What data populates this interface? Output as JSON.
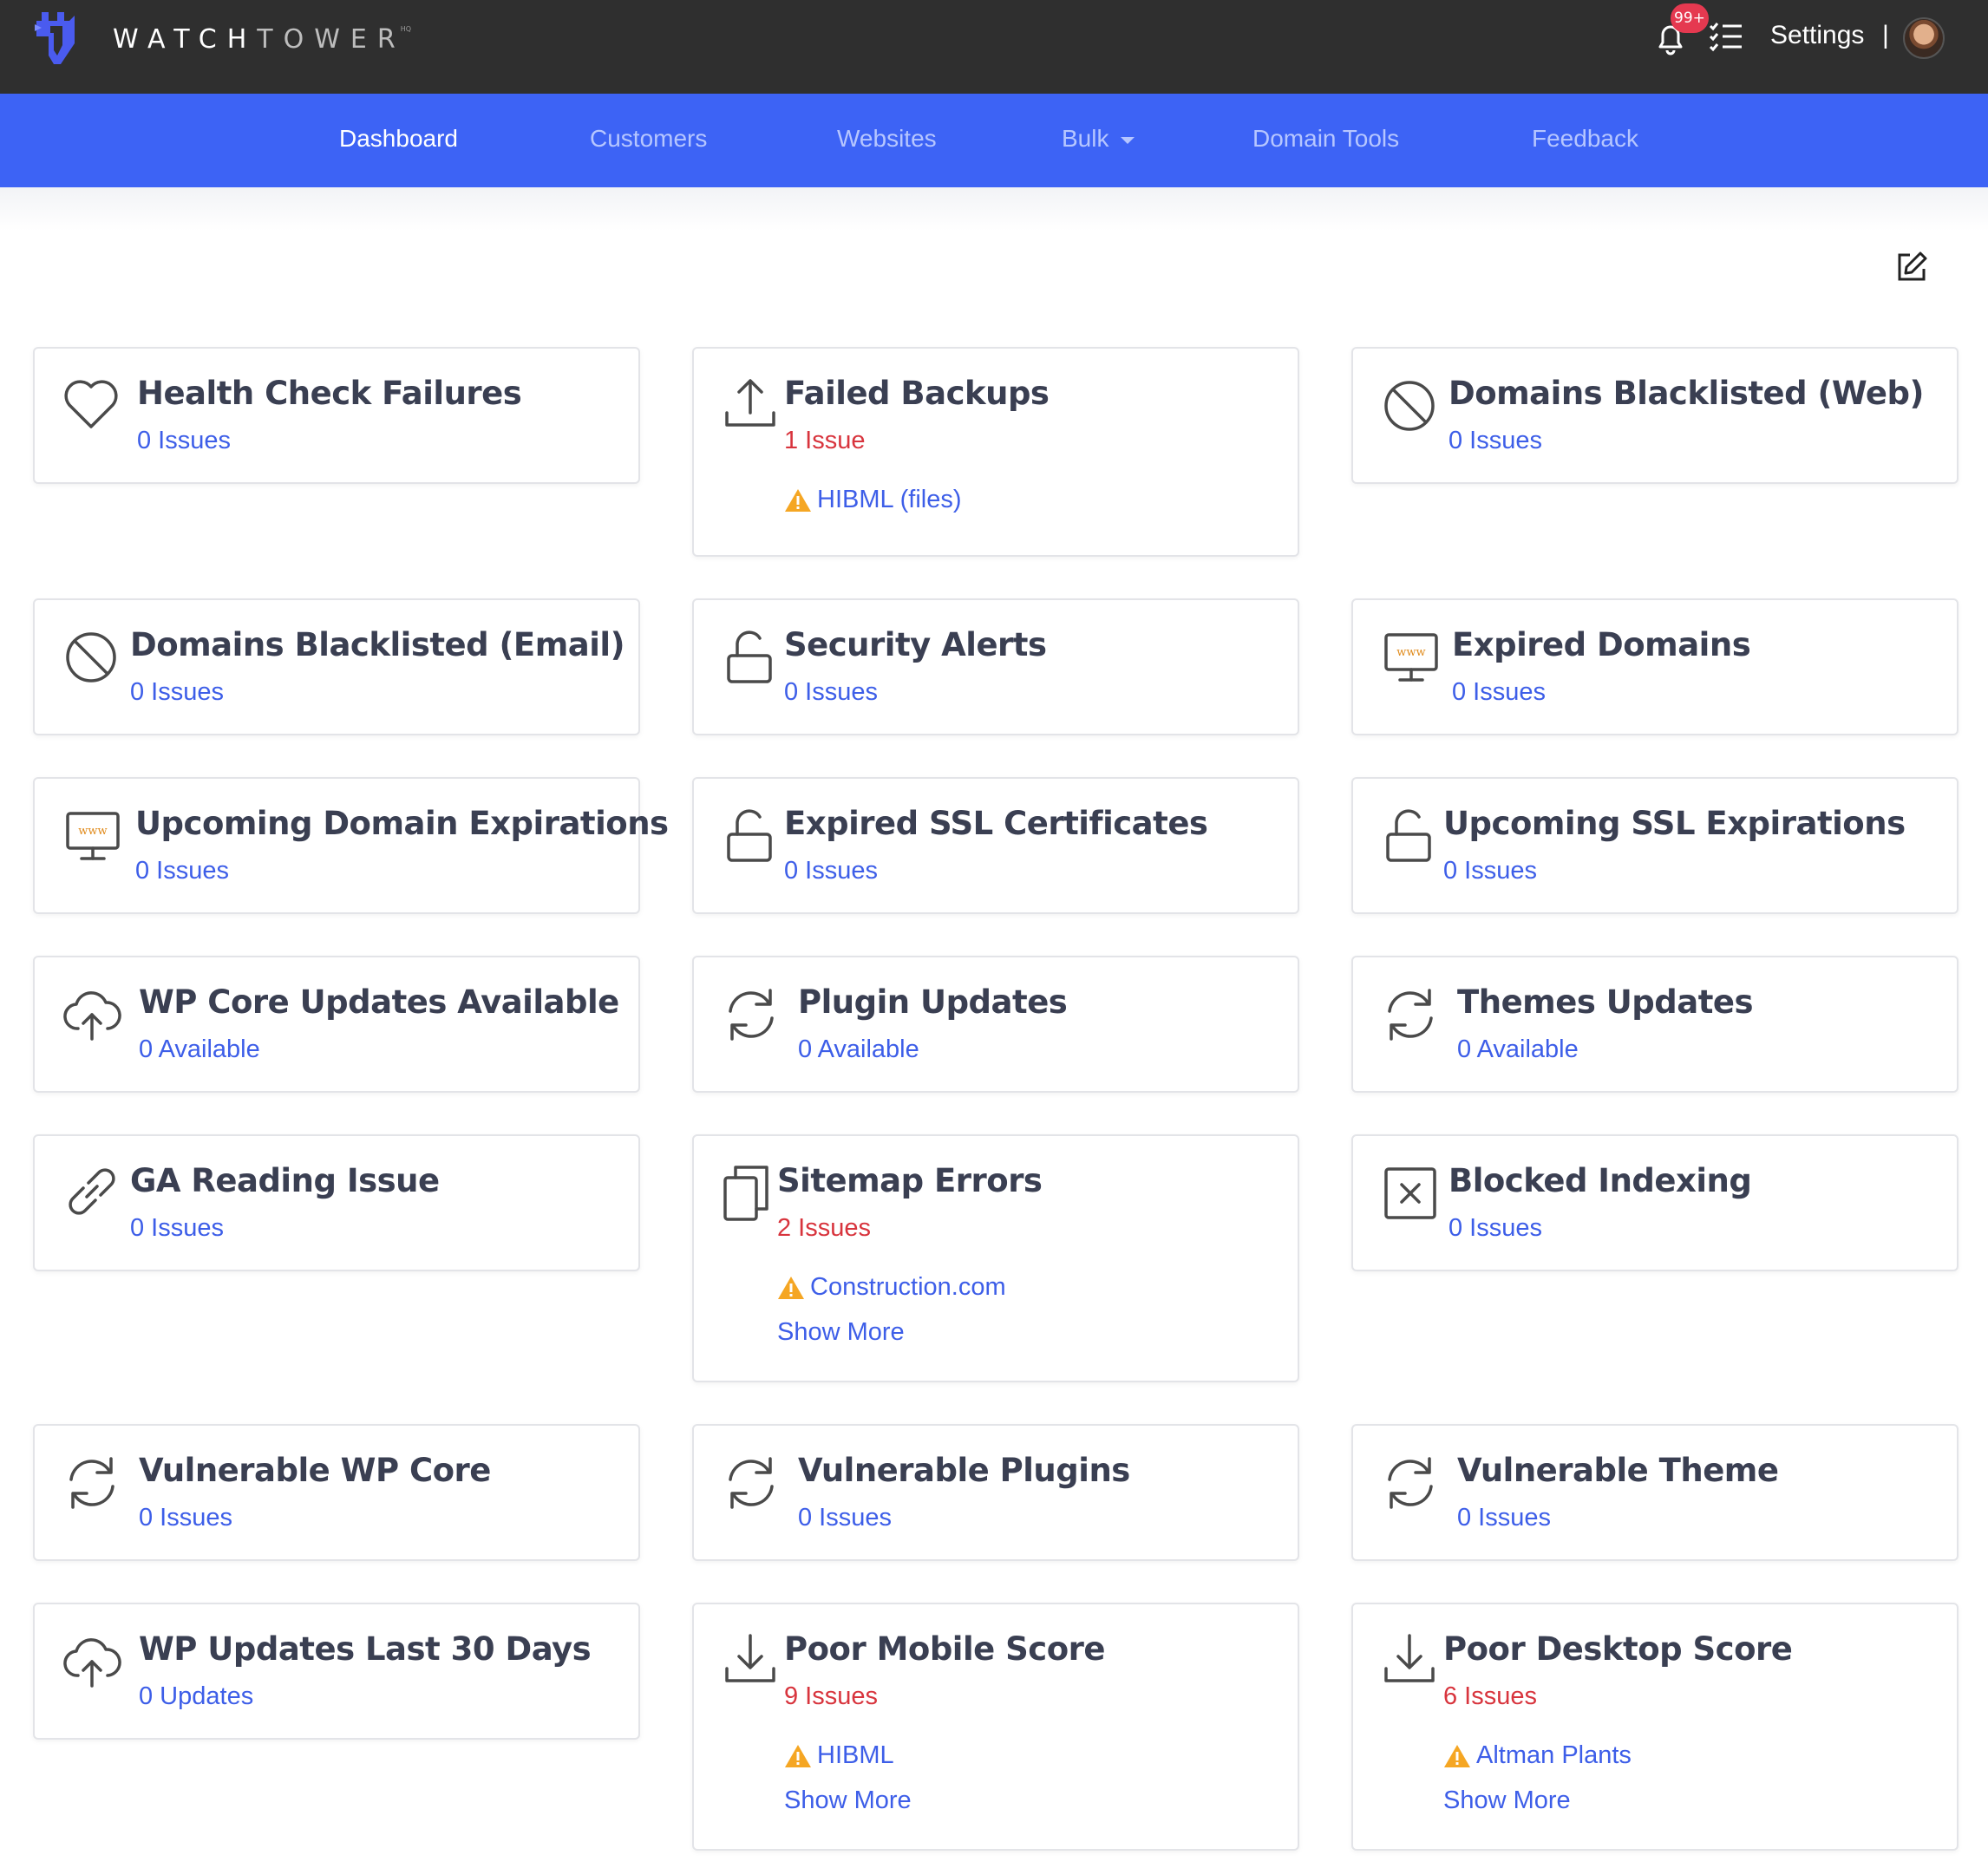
{
  "brand": {
    "name_a": "WATCH",
    "name_b": "TOWER",
    "suffix": "HQ"
  },
  "header": {
    "notifications_badge": "99+",
    "settings_label": "Settings",
    "separator": "|"
  },
  "nav": [
    {
      "label": "Dashboard",
      "active": true
    },
    {
      "label": "Customers"
    },
    {
      "label": "Websites"
    },
    {
      "label": "Bulk"
    },
    {
      "label": "Domain Tools"
    },
    {
      "label": "Feedback"
    }
  ],
  "colors": {
    "nav_bg": "#3d63f5",
    "topbar_bg": "#2f2f2f",
    "link": "#3d5ee8",
    "alert": "#d8343d",
    "warning": "#f5a623"
  },
  "cards": [
    {
      "title": "Health Check Failures",
      "count": "0 Issues",
      "icon": "heart-icon"
    },
    {
      "title": "Failed Backups",
      "count": "1 Issue",
      "icon": "upload-icon",
      "detail": "HIBML (files)"
    },
    {
      "title": "Domains Blacklisted (Web)",
      "count": "0 Issues",
      "icon": "ban-icon"
    },
    {
      "title": "Domains Blacklisted (Email)",
      "count": "0 Issues",
      "icon": "ban-icon"
    },
    {
      "title": "Security Alerts",
      "count": "0 Issues",
      "icon": "unlock-icon"
    },
    {
      "title": "Expired Domains",
      "count": "0 Issues",
      "icon": "www-monitor-icon",
      "icon_text": "www"
    },
    {
      "title": "Upcoming Domain Expirations",
      "count": "0 Issues",
      "icon": "www-monitor-icon",
      "icon_text": "www"
    },
    {
      "title": "Expired SSL Certificates",
      "count": "0 Issues",
      "icon": "unlock-icon"
    },
    {
      "title": "Upcoming SSL Expirations",
      "count": "0 Issues",
      "icon": "unlock-icon"
    },
    {
      "title": "WP Core Updates Available",
      "count": "0 Available",
      "icon": "cloud-upload-icon"
    },
    {
      "title": "Plugin Updates",
      "count": "0 Available",
      "icon": "refresh-icon"
    },
    {
      "title": "Themes Updates",
      "count": "0 Available",
      "icon": "refresh-icon"
    },
    {
      "title": "GA Reading Issue",
      "count": "0 Issues",
      "icon": "link-icon"
    },
    {
      "title": "Sitemap Errors",
      "count": "2 Issues",
      "icon": "copy-icon",
      "detail": "Construction.com",
      "more": "Show More"
    },
    {
      "title": "Blocked Indexing",
      "count": "0 Issues",
      "icon": "x-square-icon"
    },
    {
      "title": "Vulnerable WP Core",
      "count": "0 Issues",
      "icon": "refresh-icon"
    },
    {
      "title": "Vulnerable Plugins",
      "count": "0 Issues",
      "icon": "refresh-icon"
    },
    {
      "title": "Vulnerable Theme",
      "count": "0 Issues",
      "icon": "refresh-icon"
    },
    {
      "title": "WP Updates Last 30 Days",
      "count": "0 Updates",
      "icon": "cloud-upload-icon"
    },
    {
      "title": "Poor Mobile Score",
      "count": "9 Issues",
      "icon": "download-icon",
      "detail": "HIBML",
      "more": "Show More"
    },
    {
      "title": "Poor Desktop Score",
      "count": "6 Issues",
      "icon": "download-icon",
      "detail": "Altman Plants",
      "more": "Show More"
    }
  ]
}
